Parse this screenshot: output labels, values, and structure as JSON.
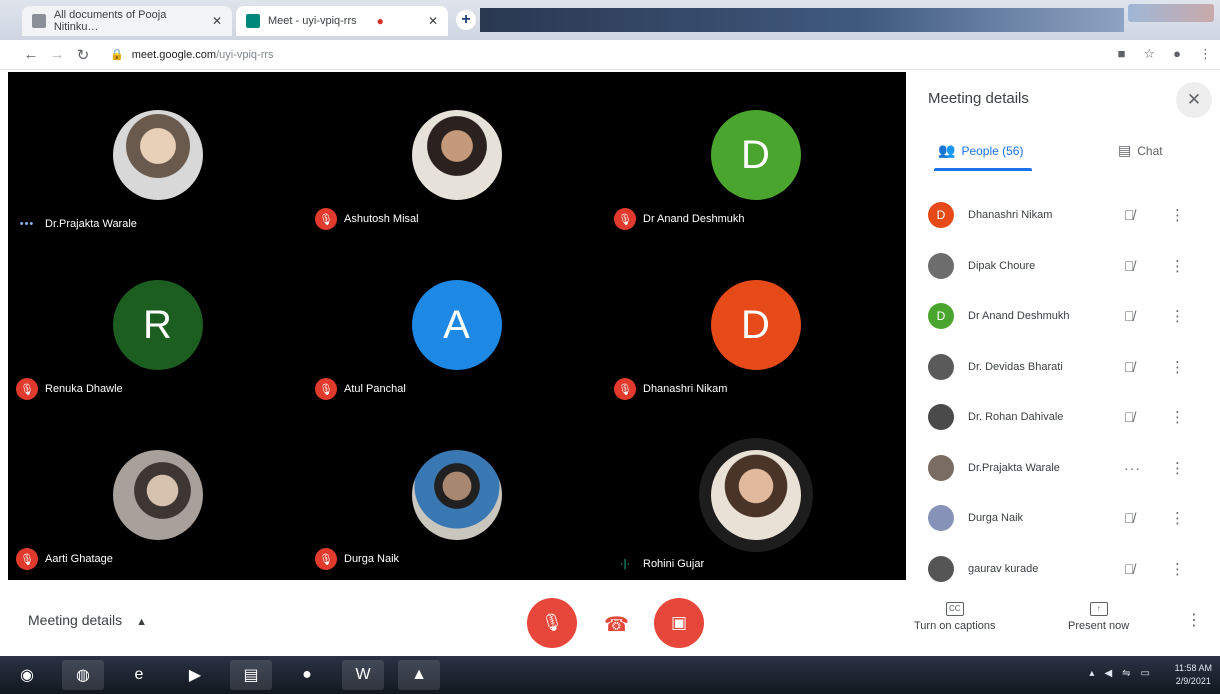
{
  "browser": {
    "tabs": [
      {
        "title": "All documents of Pooja Nitinku…",
        "close": "✕"
      },
      {
        "title": "Meet - uyi-vpiq-rrs",
        "close": "✕"
      }
    ],
    "new_tab": "+",
    "url_host": "meet.google.com",
    "url_path": "/uyi-vpiq-rrs"
  },
  "grid": {
    "tiles": [
      {
        "name": "Dr.Prajakta Warale",
        "avatar": "",
        "status": "speaking-dots"
      },
      {
        "name": "Ashutosh Misal",
        "avatar": "",
        "status": "muted"
      },
      {
        "name": "Dr Anand Deshmukh",
        "avatar": "D",
        "color": "#4aa52e",
        "status": "muted"
      },
      {
        "name": "Renuka Dhawle",
        "avatar": "R",
        "color": "#1b5e20",
        "status": "muted"
      },
      {
        "name": "Atul Panchal",
        "avatar": "A",
        "color": "#1e88e5",
        "status": "muted"
      },
      {
        "name": "Dhanashri Nikam",
        "avatar": "D",
        "color": "#e64a19",
        "status": "muted"
      },
      {
        "name": "Aarti Ghatage",
        "avatar": "",
        "status": "muted"
      },
      {
        "name": "Durga Naik",
        "avatar": "",
        "status": "muted"
      },
      {
        "name": "Rohini Gujar",
        "avatar": "",
        "status": "speaking"
      }
    ]
  },
  "panel": {
    "title": "Meeting details",
    "close": "✕",
    "tab_people": "People (56)",
    "tab_chat": "Chat",
    "people": [
      {
        "name": "Dhanashri Nikam",
        "initial": "D",
        "color": "#e64a19"
      },
      {
        "name": "Dipak Choure",
        "initial": "",
        "color": "#6d6d6d"
      },
      {
        "name": "Dr Anand Deshmukh",
        "initial": "D",
        "color": "#4aa52e"
      },
      {
        "name": "Dr. Devidas Bharati",
        "initial": "",
        "color": "#5a5a5a"
      },
      {
        "name": "Dr. Rohan Dahivale",
        "initial": "",
        "color": "#4a4a4a"
      },
      {
        "name": "Dr.Prajakta Warale",
        "initial": "",
        "color": "#7a6c60"
      },
      {
        "name": "Durga Naik",
        "initial": "",
        "color": "#8792b8"
      },
      {
        "name": "gaurav kurade",
        "initial": "",
        "color": "#555555"
      }
    ]
  },
  "bottom": {
    "meeting_details": "Meeting details",
    "captions": "Turn on captions",
    "present": "Present now"
  },
  "taskbar": {
    "time": "11:58 AM",
    "date": "2/9/2021"
  }
}
